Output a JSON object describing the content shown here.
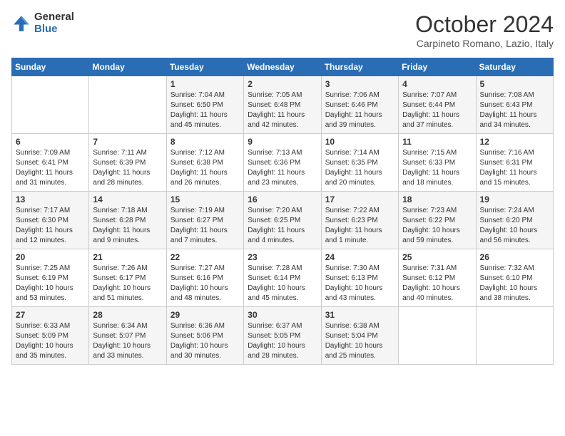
{
  "logo": {
    "general": "General",
    "blue": "Blue"
  },
  "title": "October 2024",
  "location": "Carpineto Romano, Lazio, Italy",
  "weekdays": [
    "Sunday",
    "Monday",
    "Tuesday",
    "Wednesday",
    "Thursday",
    "Friday",
    "Saturday"
  ],
  "weeks": [
    [
      {
        "day": "",
        "info": ""
      },
      {
        "day": "",
        "info": ""
      },
      {
        "day": "1",
        "info": "Sunrise: 7:04 AM\nSunset: 6:50 PM\nDaylight: 11 hours and 45 minutes."
      },
      {
        "day": "2",
        "info": "Sunrise: 7:05 AM\nSunset: 6:48 PM\nDaylight: 11 hours and 42 minutes."
      },
      {
        "day": "3",
        "info": "Sunrise: 7:06 AM\nSunset: 6:46 PM\nDaylight: 11 hours and 39 minutes."
      },
      {
        "day": "4",
        "info": "Sunrise: 7:07 AM\nSunset: 6:44 PM\nDaylight: 11 hours and 37 minutes."
      },
      {
        "day": "5",
        "info": "Sunrise: 7:08 AM\nSunset: 6:43 PM\nDaylight: 11 hours and 34 minutes."
      }
    ],
    [
      {
        "day": "6",
        "info": "Sunrise: 7:09 AM\nSunset: 6:41 PM\nDaylight: 11 hours and 31 minutes."
      },
      {
        "day": "7",
        "info": "Sunrise: 7:11 AM\nSunset: 6:39 PM\nDaylight: 11 hours and 28 minutes."
      },
      {
        "day": "8",
        "info": "Sunrise: 7:12 AM\nSunset: 6:38 PM\nDaylight: 11 hours and 26 minutes."
      },
      {
        "day": "9",
        "info": "Sunrise: 7:13 AM\nSunset: 6:36 PM\nDaylight: 11 hours and 23 minutes."
      },
      {
        "day": "10",
        "info": "Sunrise: 7:14 AM\nSunset: 6:35 PM\nDaylight: 11 hours and 20 minutes."
      },
      {
        "day": "11",
        "info": "Sunrise: 7:15 AM\nSunset: 6:33 PM\nDaylight: 11 hours and 18 minutes."
      },
      {
        "day": "12",
        "info": "Sunrise: 7:16 AM\nSunset: 6:31 PM\nDaylight: 11 hours and 15 minutes."
      }
    ],
    [
      {
        "day": "13",
        "info": "Sunrise: 7:17 AM\nSunset: 6:30 PM\nDaylight: 11 hours and 12 minutes."
      },
      {
        "day": "14",
        "info": "Sunrise: 7:18 AM\nSunset: 6:28 PM\nDaylight: 11 hours and 9 minutes."
      },
      {
        "day": "15",
        "info": "Sunrise: 7:19 AM\nSunset: 6:27 PM\nDaylight: 11 hours and 7 minutes."
      },
      {
        "day": "16",
        "info": "Sunrise: 7:20 AM\nSunset: 6:25 PM\nDaylight: 11 hours and 4 minutes."
      },
      {
        "day": "17",
        "info": "Sunrise: 7:22 AM\nSunset: 6:23 PM\nDaylight: 11 hours and 1 minute."
      },
      {
        "day": "18",
        "info": "Sunrise: 7:23 AM\nSunset: 6:22 PM\nDaylight: 10 hours and 59 minutes."
      },
      {
        "day": "19",
        "info": "Sunrise: 7:24 AM\nSunset: 6:20 PM\nDaylight: 10 hours and 56 minutes."
      }
    ],
    [
      {
        "day": "20",
        "info": "Sunrise: 7:25 AM\nSunset: 6:19 PM\nDaylight: 10 hours and 53 minutes."
      },
      {
        "day": "21",
        "info": "Sunrise: 7:26 AM\nSunset: 6:17 PM\nDaylight: 10 hours and 51 minutes."
      },
      {
        "day": "22",
        "info": "Sunrise: 7:27 AM\nSunset: 6:16 PM\nDaylight: 10 hours and 48 minutes."
      },
      {
        "day": "23",
        "info": "Sunrise: 7:28 AM\nSunset: 6:14 PM\nDaylight: 10 hours and 45 minutes."
      },
      {
        "day": "24",
        "info": "Sunrise: 7:30 AM\nSunset: 6:13 PM\nDaylight: 10 hours and 43 minutes."
      },
      {
        "day": "25",
        "info": "Sunrise: 7:31 AM\nSunset: 6:12 PM\nDaylight: 10 hours and 40 minutes."
      },
      {
        "day": "26",
        "info": "Sunrise: 7:32 AM\nSunset: 6:10 PM\nDaylight: 10 hours and 38 minutes."
      }
    ],
    [
      {
        "day": "27",
        "info": "Sunrise: 6:33 AM\nSunset: 5:09 PM\nDaylight: 10 hours and 35 minutes."
      },
      {
        "day": "28",
        "info": "Sunrise: 6:34 AM\nSunset: 5:07 PM\nDaylight: 10 hours and 33 minutes."
      },
      {
        "day": "29",
        "info": "Sunrise: 6:36 AM\nSunset: 5:06 PM\nDaylight: 10 hours and 30 minutes."
      },
      {
        "day": "30",
        "info": "Sunrise: 6:37 AM\nSunset: 5:05 PM\nDaylight: 10 hours and 28 minutes."
      },
      {
        "day": "31",
        "info": "Sunrise: 6:38 AM\nSunset: 5:04 PM\nDaylight: 10 hours and 25 minutes."
      },
      {
        "day": "",
        "info": ""
      },
      {
        "day": "",
        "info": ""
      }
    ]
  ]
}
